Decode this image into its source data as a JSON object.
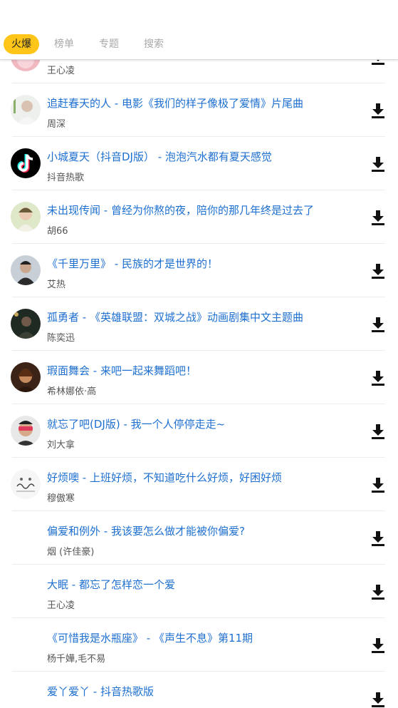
{
  "tabs": [
    {
      "label": "火爆",
      "active": true
    },
    {
      "label": "榜单",
      "active": false
    },
    {
      "label": "专题",
      "active": false
    },
    {
      "label": "搜索",
      "active": false
    }
  ],
  "songs": [
    {
      "title": "",
      "artist": "王心凌",
      "avatar": "pink-cover"
    },
    {
      "title": "追赶春天的人 - 电影《我们的样子像极了爱情》片尾曲",
      "artist": "周深",
      "avatar": "portrait-light"
    },
    {
      "title": "小城夏天（抖音DJ版） - 泡泡汽水都有夏天感觉",
      "artist": "抖音热歌",
      "avatar": "tiktok-logo"
    },
    {
      "title": "未出现传闻 - 曾经为你熬的夜，陪你的那几年终是过去了",
      "artist": "胡66",
      "avatar": "portrait-green"
    },
    {
      "title": "《千里万里》 - 民族的才是世界的！",
      "artist": "艾热",
      "avatar": "portrait-dark"
    },
    {
      "title": "孤勇者 - 《英雄联盟：双城之战》动画剧集中文主题曲",
      "artist": "陈奕迅",
      "avatar": "portrait-night"
    },
    {
      "title": "瑕面舞会 - 来吧一起来舞蹈吧！",
      "artist": "希林娜依·高",
      "avatar": "portrait-brown"
    },
    {
      "title": "就忘了吧(DJ版) - 我一个人停停走走~",
      "artist": "刘大拿",
      "avatar": "portrait-red"
    },
    {
      "title": "好烦噢 - 上班好烦，不知道吃什么好烦，好困好烦",
      "artist": "穆傲寒",
      "avatar": "sketch-cover"
    },
    {
      "title": "偏爱和例外 - 我该要怎么做才能被你偏爱?",
      "artist": "烟 (许佳豪)",
      "avatar": "none"
    },
    {
      "title": "大眠 - 都忘了怎样恋一个爱",
      "artist": "王心凌",
      "avatar": "none"
    },
    {
      "title": "《可惜我是水瓶座》 - 《声生不息》第11期",
      "artist": "杨千嬅,毛不易",
      "avatar": "none"
    },
    {
      "title": "爱丫爱丫 - 抖音热歌版",
      "artist": "",
      "avatar": "none"
    }
  ],
  "icons": {
    "download": "download-icon"
  },
  "colors": {
    "accent": "#ffc519",
    "title": "#1d6fd0",
    "artist": "#555555"
  }
}
